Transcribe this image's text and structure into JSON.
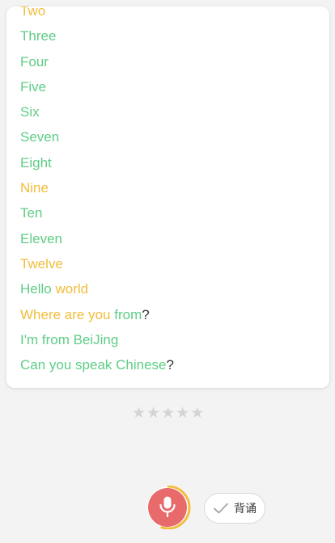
{
  "sentences": [
    {
      "segments": [
        {
          "text": "Two",
          "status": "mid"
        }
      ]
    },
    {
      "segments": [
        {
          "text": "Three",
          "status": "ok"
        }
      ]
    },
    {
      "segments": [
        {
          "text": "Four",
          "status": "ok"
        }
      ]
    },
    {
      "segments": [
        {
          "text": "Five",
          "status": "ok"
        }
      ]
    },
    {
      "segments": [
        {
          "text": "Six",
          "status": "ok"
        }
      ]
    },
    {
      "segments": [
        {
          "text": "Seven",
          "status": "ok"
        }
      ]
    },
    {
      "segments": [
        {
          "text": "Eight",
          "status": "ok"
        }
      ]
    },
    {
      "segments": [
        {
          "text": "Nine",
          "status": "mid"
        }
      ]
    },
    {
      "segments": [
        {
          "text": "Ten",
          "status": "ok"
        }
      ]
    },
    {
      "segments": [
        {
          "text": "Eleven",
          "status": "ok"
        }
      ]
    },
    {
      "segments": [
        {
          "text": "Twelve",
          "status": "mid"
        }
      ]
    },
    {
      "segments": [
        {
          "text": "Hello ",
          "status": "ok"
        },
        {
          "text": "world",
          "status": "mid"
        }
      ]
    },
    {
      "segments": [
        {
          "text": "Where are you ",
          "status": "mid"
        },
        {
          "text": "from",
          "status": "ok"
        },
        {
          "text": "?",
          "status": "plain"
        }
      ]
    },
    {
      "segments": [
        {
          "text": "I'm from BeiJing",
          "status": "ok"
        }
      ]
    },
    {
      "segments": [
        {
          "text": "Can you speak Chinese",
          "status": "ok"
        },
        {
          "text": "?",
          "status": "plain"
        }
      ]
    }
  ],
  "rating": {
    "max": 5,
    "filled": 0
  },
  "record": {
    "icon": "microphone-icon",
    "progress": 0.55
  },
  "recite_button": {
    "icon": "check-icon",
    "label": "背诵"
  },
  "colors": {
    "ok": "#5fcd86",
    "mid": "#f2bd3c",
    "mic": "#e86a6a",
    "ring": "#f2bd3c",
    "star_empty": "#d4d4d4"
  }
}
